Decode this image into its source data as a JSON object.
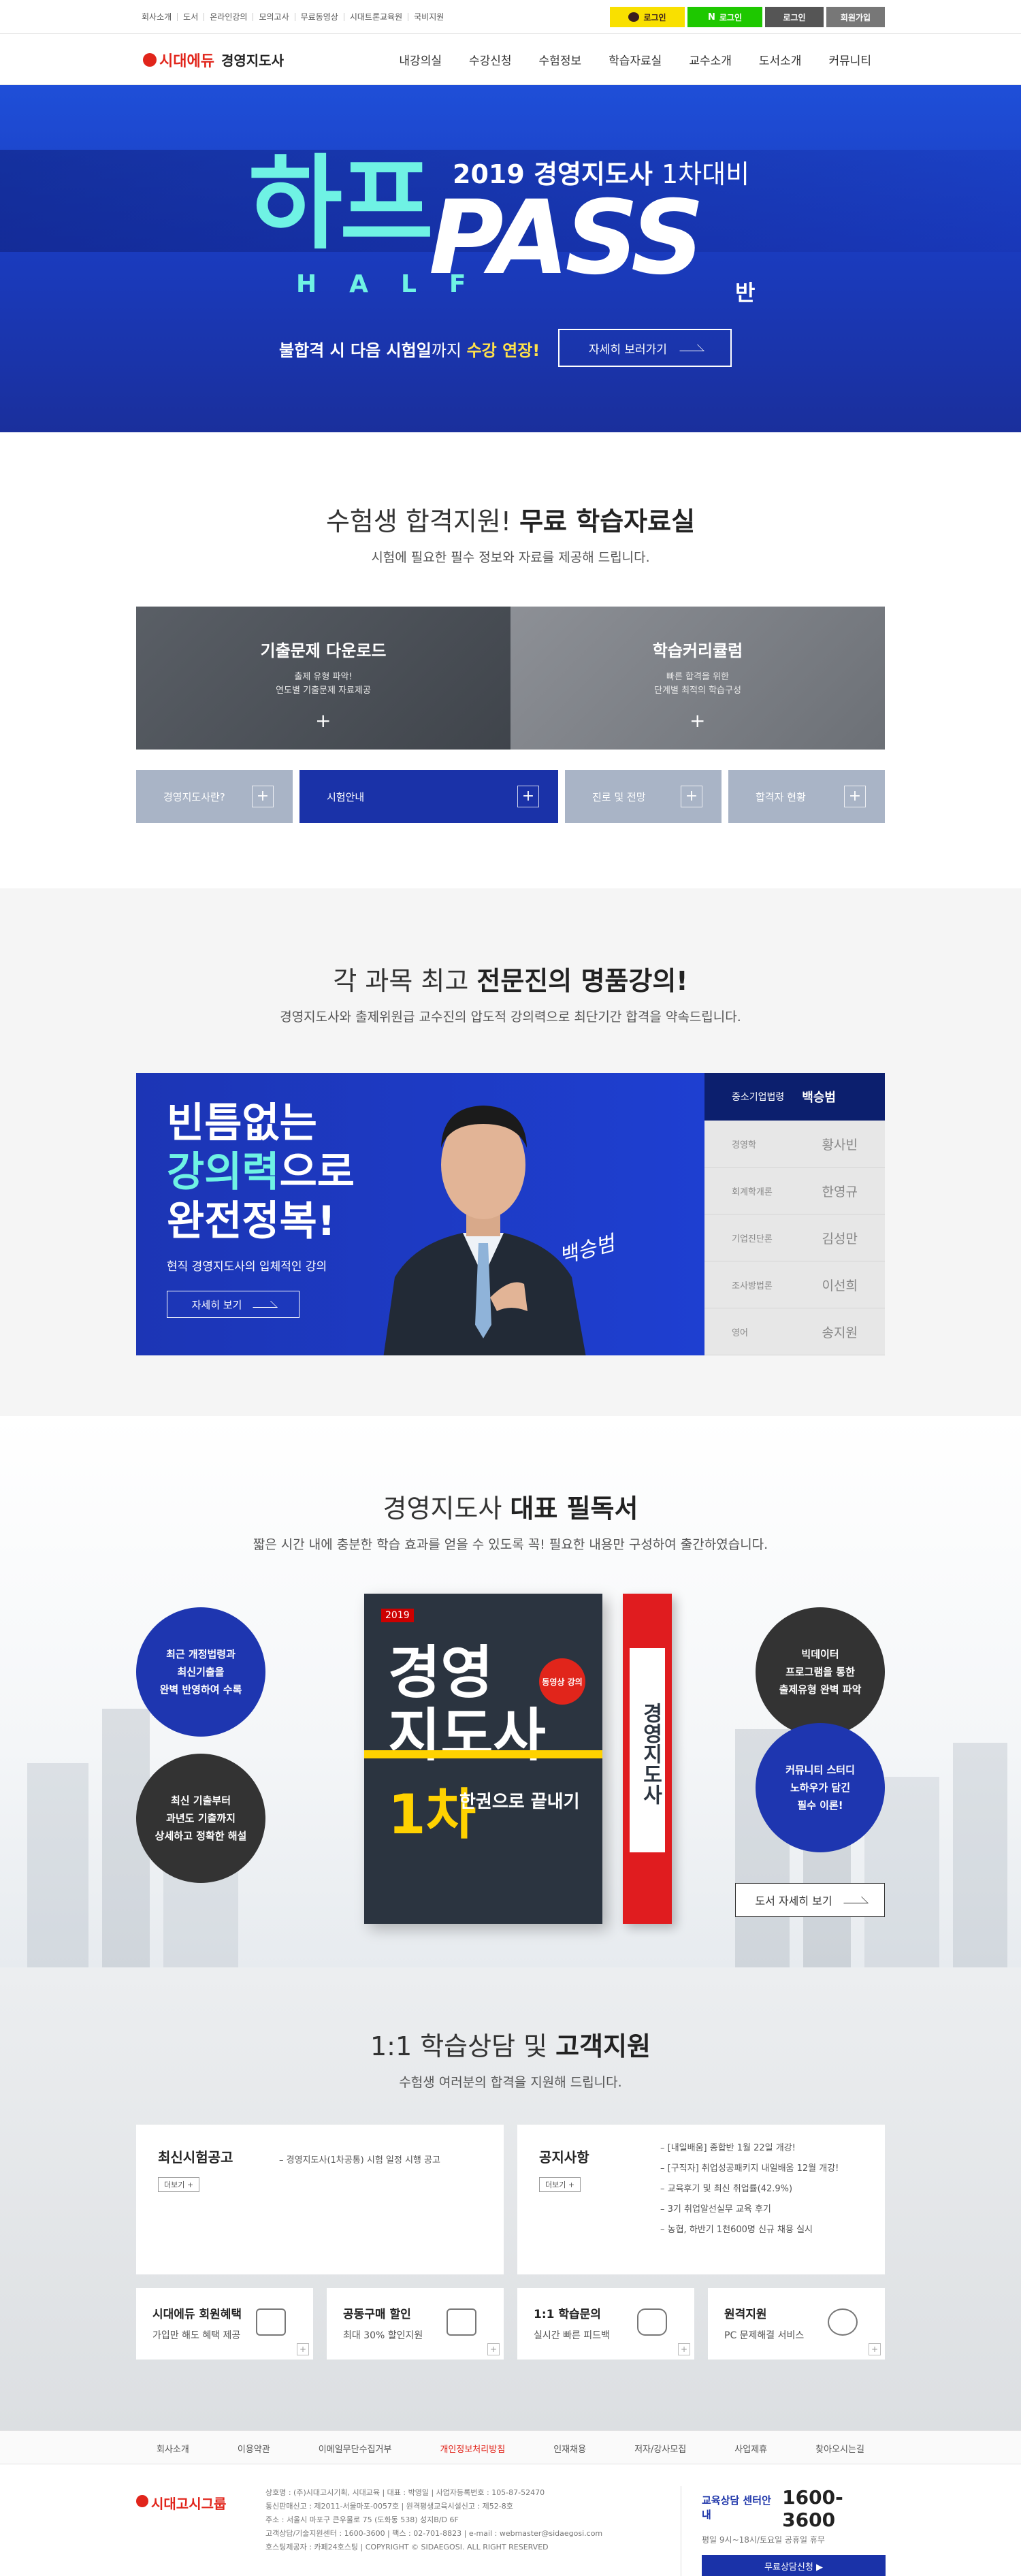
{
  "util": {
    "links": [
      "회사소개",
      "도서",
      "온라인강의",
      "모의고사",
      "무료동영상",
      "시대트론교육원",
      "국비지원"
    ],
    "kakao_login": "로그인",
    "naver_login": "로그인",
    "login": "로그인",
    "join": "회원가입"
  },
  "gnb": {
    "logo": "시대에듀",
    "subtitle": "경영지도사",
    "menu": [
      "내강의실",
      "수강신청",
      "수험정보",
      "학습자료실",
      "교수소개",
      "도서소개",
      "커뮤니티"
    ]
  },
  "hero": {
    "half_ko": "하프",
    "year": "2019 경영지도사",
    "round": "1차대비",
    "half_en": "HALF",
    "pass": "PASS",
    "ban": "반",
    "copy_a": "불합격 시 다음 시험일",
    "copy_b": "까지 ",
    "copy_hl": "수강 연장!",
    "btn": "자세히 보러가기"
  },
  "free": {
    "title_a": "수험생 합격지원! ",
    "title_b": "무료 학습자료실",
    "sub": "시험에 필요한 필수 정보와 자료를 제공해 드립니다.",
    "cards": [
      {
        "title": "기출문제 다운로드",
        "line1": "출제 유형 파악!",
        "line2": "연도별 기출문제 자료제공"
      },
      {
        "title": "학습커리큘럼",
        "line1": "빠른 합격을 위한",
        "line2": "단계별 최적의 학습구성"
      }
    ],
    "tabs": [
      "경영지도사란?",
      "시험안내",
      "진로 및 전망",
      "합격자 현황"
    ]
  },
  "lecture": {
    "title_a": "각 과목 최고 ",
    "title_b": "전문진의 명품강의!",
    "sub": "경영지도사와 출제위원급 교수진의 압도적 강의력으로 최단기간 합격을 약속드립니다.",
    "h1": "빈틈없는",
    "h2": "강의력",
    "h2b": "으로",
    "h3": "완전정복!",
    "desc": "현직 경영지도사의 입체적인 강의",
    "btn": "자세히 보기",
    "signature": "백승범",
    "list_head": {
      "subject": "중소기업법령",
      "name": "백승범"
    },
    "list": [
      {
        "subject": "경영학",
        "name": "황사빈"
      },
      {
        "subject": "회계학개론",
        "name": "한영규"
      },
      {
        "subject": "기업진단론",
        "name": "김성만"
      },
      {
        "subject": "조사방법론",
        "name": "이선희"
      },
      {
        "subject": "영어",
        "name": "송지원"
      }
    ]
  },
  "books": {
    "title_a": "경영지도사 ",
    "title_b": "대표 필독서",
    "sub": "짧은 시간 내에 충분한 학습 효과를 얻을 수 있도록 꼭! 필요한 내용만 구성하여 출간하였습니다.",
    "c1": [
      "최근 개정법령과",
      "최신기출을",
      "완벽 반영하여 수록"
    ],
    "c2": [
      "최신 기출부터",
      "과년도 기출까지",
      "상세하고 정확한 해설"
    ],
    "c3": [
      "빅데이터",
      "프로그램을 통한",
      "출제유형 완벽 파악"
    ],
    "c4": [
      "커뮤니티 스터디",
      "노하우가 담긴",
      "필수 이론!"
    ],
    "book_year": "2019",
    "book_t1": "경영",
    "book_t2": "지도사",
    "book_t3": "1차",
    "book_t4": "한권으로 끝내기",
    "book_badge": "동영상 강의",
    "spine": "경영지도사",
    "btn": "도서 자세히 보기"
  },
  "support": {
    "title_a": "1:1 학습상담 및 ",
    "title_b": "고객지원",
    "sub": "수험생 여러분의 합격을 지원해 드립니다.",
    "box1": {
      "title": "최신시험공고",
      "more": "더보기 +",
      "items": [
        "경영지도사(1차공통) 시험 일정 시행 공고"
      ]
    },
    "box2": {
      "title": "공지사항",
      "more": "더보기 +",
      "items": [
        "[내일배움] 종합반 1월 22일 개강!",
        "[구직자] 취업성공패키지 내일배움 12월 개강!",
        "교육후기 및 최신 취업률(42.9%)",
        "3기 취업알선실무 교육 후기",
        "농협, 하반기 1천600명 신규 채용 실시"
      ]
    },
    "small": [
      {
        "title": "시대에듀 회원혜택",
        "desc": "가입만 해도 혜택 제공"
      },
      {
        "title": "공동구매 할인",
        "desc": "최대 30% 할인지원"
      },
      {
        "title": "1:1 학습문의",
        "desc": "실시간 빠른 피드백"
      },
      {
        "title": "원격지원",
        "desc": "PC 문제해결 서비스"
      }
    ]
  },
  "footer": {
    "links": [
      "회사소개",
      "이용약관",
      "이메일무단수집거부",
      "개인정보처리방침",
      "인재채용",
      "저자/강사모집",
      "사업제휴",
      "찾아오시는길"
    ],
    "logo": "시대고시그룹",
    "info": [
      "상호명 : (주)시대고시기획, 시대교육 | 대표 : 박영일 | 사업자등록번호 : 105-87-52470",
      "통신판매신고 : 제2011-서울마포-0057호 | 원격평생교육시설신고 : 제52-8호",
      "주소 : 서울시 마포구 큰우물로 75 (도화동 538) 성지B/D 6F",
      "고객상담/기술지원센터 : 1600-3600 | 팩스 : 02-701-8823 | e-mail : webmaster@sidaegosi.com",
      "호스팅제공자 : 카페24호스팅 | COPYRIGHT © SIDAEGOSI. ALL RIGHT RESERVED"
    ],
    "cs_label": "교육상담 센터안내",
    "cs_phone": "1600-3600",
    "cs_hours": "평일 9시~18시/토요일 공휴일 휴무",
    "cs_btn": "무료상담신청 ▶"
  }
}
